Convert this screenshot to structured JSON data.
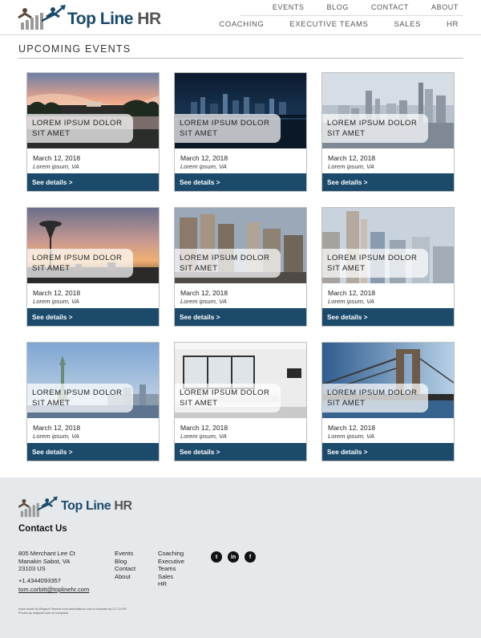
{
  "header": {
    "logo": {
      "word1": "Top Line",
      "word2": "HR"
    },
    "nav_top": [
      "EVENTS",
      "BLOG",
      "CONTACT",
      "ABOUT"
    ],
    "nav_bottom": [
      "COACHING",
      "EXECUTIVE TEAMS",
      "SALES",
      "HR"
    ]
  },
  "main": {
    "section_title": "UPCOMING EVENTS",
    "cards": [
      {
        "title_line1": "LOREM IPSUM DOLOR",
        "title_line2": "SIT AMET",
        "date": "March 12, 2018",
        "location": "Lorem ipsum, VA",
        "button": "See details >",
        "image": "washington-dc-sunset"
      },
      {
        "title_line1": "LOREM IPSUM DOLOR",
        "title_line2": "SIT AMET",
        "date": "March 12, 2018",
        "location": "Lorem ipsum, VA",
        "button": "See details >",
        "image": "city-skyline-night"
      },
      {
        "title_line1": "LOREM IPSUM DOLOR",
        "title_line2": "SIT AMET",
        "date": "March 12, 2018",
        "location": "Lorem ipsum, VA",
        "button": "See details >",
        "image": "city-skyline-day"
      },
      {
        "title_line1": "LOREM IPSUM DOLOR",
        "title_line2": "SIT AMET",
        "date": "March 12, 2018",
        "location": "Lorem ipsum, VA",
        "button": "See details >",
        "image": "space-needle-sunset"
      },
      {
        "title_line1": "LOREM IPSUM DOLOR",
        "title_line2": "SIT AMET",
        "date": "March 12, 2018",
        "location": "Lorem ipsum, VA",
        "button": "See details >",
        "image": "downtown-towers"
      },
      {
        "title_line1": "LOREM IPSUM DOLOR",
        "title_line2": "SIT AMET",
        "date": "March 12, 2018",
        "location": "Lorem ipsum, VA",
        "button": "See details >",
        "image": "skyscrapers-haze"
      },
      {
        "title_line1": "LOREM IPSUM DOLOR",
        "title_line2": "SIT AMET",
        "date": "March 12, 2018",
        "location": "Lorem ipsum, VA",
        "button": "See details >",
        "image": "statue-of-liberty"
      },
      {
        "title_line1": "LOREM IPSUM DOLOR",
        "title_line2": "SIT AMET",
        "date": "March 12, 2018",
        "location": "Lorem ipsum, VA",
        "button": "See details >",
        "image": "conference-room"
      },
      {
        "title_line1": "LOREM IPSUM DOLOR",
        "title_line2": "SIT AMET",
        "date": "March 12, 2018",
        "location": "Lorem ipsum, VA",
        "button": "See details >",
        "image": "brooklyn-bridge"
      }
    ]
  },
  "footer": {
    "logo": {
      "word1": "Top Line",
      "word2": "HR"
    },
    "heading": "Contact Us",
    "address": [
      "805 Merchant Lee Ct",
      "Manakin Sabot, VA",
      "23103 US"
    ],
    "phone": "+1.4344093357",
    "email": "tom.corbitt@toplinehr.com",
    "links_col1": [
      "Events",
      "Blog",
      "Contact",
      "About"
    ],
    "links_col2": [
      "Coaching",
      "Executive",
      "Teams",
      "Sales",
      "HR"
    ],
    "social": [
      {
        "icon": "twitter-icon",
        "glyph": "t"
      },
      {
        "icon": "linkedin-icon",
        "glyph": "in"
      },
      {
        "icon": "facebook-icon",
        "glyph": "f"
      }
    ],
    "credit_line1": "Icons made by Elegant Themes from www.flaticon.com is licensed by CC 3.0 BY",
    "credit_line2": "Photos by rawpixel.com on Unsplash"
  },
  "colors": {
    "brand_navy": "#1b4a6b",
    "footer_bg": "#e6e9ec"
  }
}
